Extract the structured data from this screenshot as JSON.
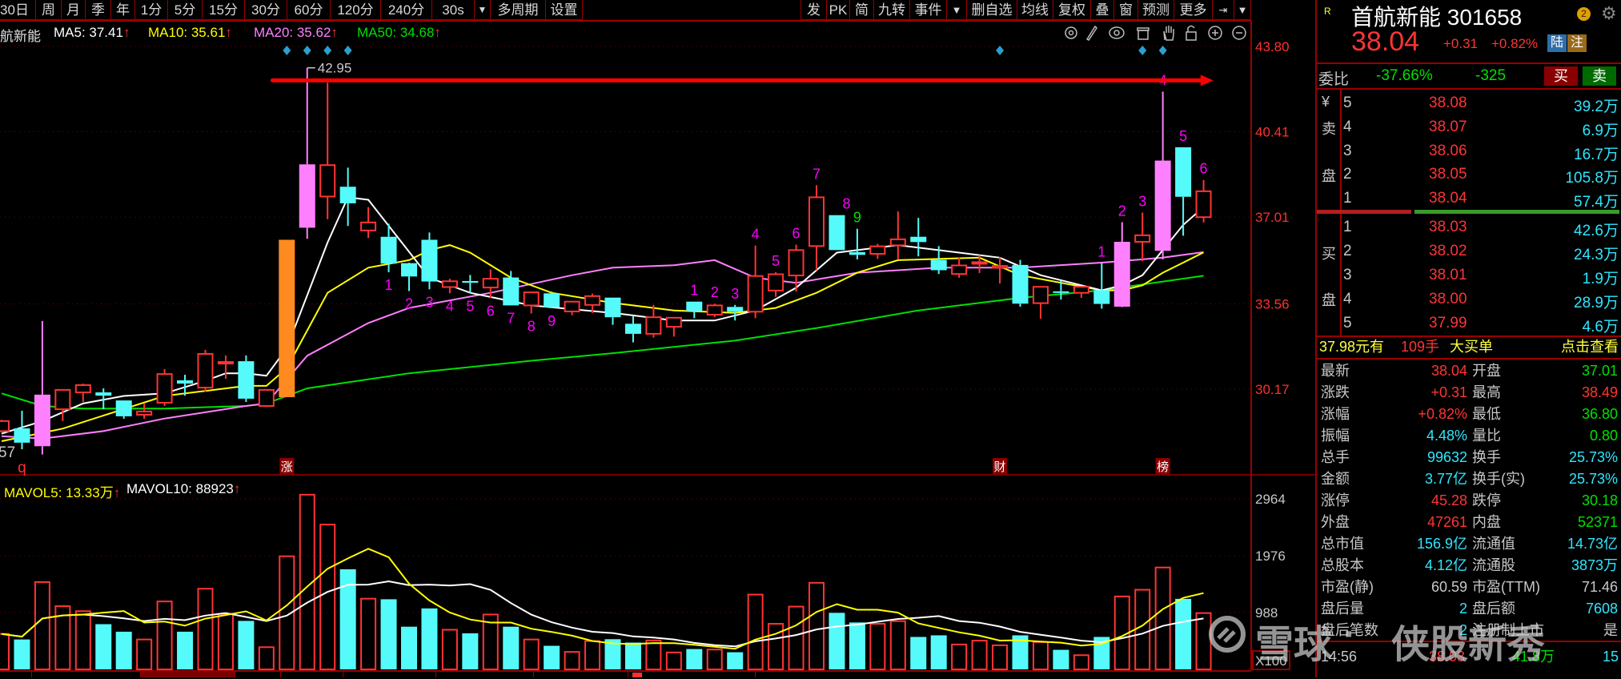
{
  "toolbar": {
    "left": [
      "30日",
      "周",
      "月",
      "季",
      "年",
      "1分",
      "5分",
      "15分",
      "30分",
      "60分",
      "120分",
      "240分",
      "30s",
      "多周期",
      "设置"
    ],
    "right": [
      "发",
      "PK",
      "简",
      "九转",
      "事件",
      "▼",
      "删自选",
      "均线",
      "复权",
      "叠",
      "窗",
      "预测",
      "更多",
      "⇥",
      "▼"
    ]
  },
  "legend": {
    "stock_name": "首航新能",
    "ma5": "MA5: 37.41",
    "ma10": "MA10: 35.61",
    "ma20": "MA20: 35.62",
    "ma50": "MA50: 34.68",
    "arrow": "↑",
    "mavol5": "MAVOL5: 13.33万",
    "mavol10": "MAVOL10: 88923"
  },
  "chart_tools": [
    "gear-icon",
    "pen-icon",
    "eye-icon",
    "basket-icon",
    "hand-icon",
    "lock-icon",
    "zoom-in-icon",
    "zoom-out-icon"
  ],
  "colors": {
    "up": "#ff3434",
    "down": "#55fbfb",
    "ma5": "#ffffff",
    "ma10": "#ffff00",
    "ma20": "#ff80ff",
    "ma50": "#00e000",
    "orange": "#ff8a20",
    "pink": "#ff80ff",
    "seq": "#ff00ff"
  },
  "chart_data": {
    "type": "candlestick",
    "price_axis": {
      "ticks": [
        "43.80",
        "40.41",
        "37.01",
        "33.56",
        "30.17"
      ],
      "values": [
        43.8,
        40.41,
        37.01,
        33.56,
        30.17
      ]
    },
    "volume_axis": {
      "ticks": [
        "2964",
        "1976",
        "988"
      ],
      "values": [
        2964,
        1976,
        988
      ],
      "unit_label": "X100"
    },
    "high_label": "42.95",
    "low_label": "57",
    "ohlc": [
      [
        28.5,
        28.95,
        28.45,
        28.9
      ],
      [
        28.61,
        29.31,
        27.78,
        28.04
      ],
      [
        27.9,
        32.88,
        27.57,
        29.95
      ],
      [
        29.37,
        30.14,
        28.9,
        30.14
      ],
      [
        30.04,
        30.39,
        29.66,
        30.33
      ],
      [
        30.04,
        30.2,
        29.37,
        29.91
      ],
      [
        29.72,
        29.72,
        28.99,
        29.09
      ],
      [
        29.15,
        29.6,
        28.99,
        29.28
      ],
      [
        29.63,
        30.97,
        29.5,
        30.77
      ],
      [
        30.52,
        30.74,
        29.91,
        30.39
      ],
      [
        30.23,
        31.73,
        30.07,
        31.57
      ],
      [
        31.19,
        31.51,
        30.58,
        31.25
      ],
      [
        31.28,
        31.51,
        29.66,
        29.79
      ],
      [
        29.5,
        30.14,
        29.47,
        30.14
      ],
      [
        29.85,
        36.11,
        29.85,
        36.11
      ],
      [
        36.59,
        42.95,
        36.15,
        39.11
      ],
      [
        37.83,
        42.36,
        36.93,
        39.08
      ],
      [
        38.22,
        38.98,
        36.66,
        37.56
      ],
      [
        36.48,
        37.41,
        36.18,
        36.8
      ],
      [
        36.23,
        36.75,
        34.82,
        35.16
      ],
      [
        35.18,
        35.2,
        34.07,
        34.65
      ],
      [
        36.11,
        36.4,
        34.14,
        34.45
      ],
      [
        34.23,
        34.56,
        33.98,
        34.46
      ],
      [
        34.47,
        34.71,
        33.98,
        34.4
      ],
      [
        34.21,
        34.93,
        33.79,
        34.56
      ],
      [
        34.61,
        34.87,
        33.5,
        33.5
      ],
      [
        33.5,
        34.02,
        33.18,
        34.02
      ],
      [
        33.98,
        34.05,
        33.39,
        33.43
      ],
      [
        33.26,
        33.65,
        33.11,
        33.65
      ],
      [
        33.52,
        33.97,
        33.2,
        33.87
      ],
      [
        33.81,
        33.81,
        32.73,
        33.03
      ],
      [
        32.77,
        33.09,
        32.03,
        32.37
      ],
      [
        32.37,
        33.52,
        32.22,
        33.03
      ],
      [
        32.65,
        33.01,
        32.26,
        33.01
      ],
      [
        33.65,
        33.65,
        32.99,
        33.27
      ],
      [
        33.13,
        33.57,
        33.04,
        33.5
      ],
      [
        33.44,
        33.52,
        32.9,
        33.25
      ],
      [
        33.25,
        35.88,
        32.99,
        34.67
      ],
      [
        34.09,
        34.82,
        33.84,
        34.74
      ],
      [
        34.69,
        35.92,
        34.05,
        35.7
      ],
      [
        35.86,
        38.28,
        34.9,
        37.8
      ],
      [
        37.09,
        37.09,
        35.7,
        35.7
      ],
      [
        35.62,
        36.55,
        35.33,
        35.51
      ],
      [
        35.55,
        35.95,
        35.35,
        35.85
      ],
      [
        35.89,
        37.24,
        35.34,
        36.13
      ],
      [
        36.23,
        36.98,
        35.45,
        36.02
      ],
      [
        35.31,
        35.86,
        34.75,
        34.9
      ],
      [
        34.75,
        35.42,
        34.6,
        35.09
      ],
      [
        35.2,
        35.5,
        34.79,
        35.22
      ],
      [
        35.0,
        35.42,
        34.37,
        35.07
      ],
      [
        35.11,
        35.31,
        33.45,
        33.57
      ],
      [
        33.59,
        34.24,
        32.97,
        34.24
      ],
      [
        34.06,
        34.49,
        33.73,
        34.04
      ],
      [
        34.0,
        34.24,
        33.8,
        34.24
      ],
      [
        34.11,
        35.18,
        33.37,
        33.56
      ],
      [
        33.45,
        36.81,
        33.43,
        36.03
      ],
      [
        36.03,
        37.19,
        35.26,
        36.29
      ],
      [
        35.67,
        42.0,
        35.33,
        39.26
      ],
      [
        39.79,
        39.79,
        36.27,
        37.82
      ],
      [
        37.01,
        38.49,
        36.8,
        38.04
      ]
    ],
    "special_fill": {
      "2": "pink",
      "14": "orange",
      "15": "pink",
      "55": "pink",
      "57": "pink"
    },
    "volume_x100": [
      617,
      520,
      1518,
      1099,
      1012,
      786,
      655,
      520,
      1181,
      655,
      1402,
      964,
      843,
      386,
      1966,
      3036,
      2516,
      1740,
      1229,
      1219,
      742,
      1060,
      689,
      627,
      954,
      742,
      520,
      410,
      304,
      492,
      525,
      466,
      503,
      294,
      354,
      345,
      298,
      1300,
      792,
      1091,
      1505,
      983,
      816,
      792,
      839,
      564,
      592,
      433,
      499,
      419,
      592,
      475,
      340,
      247,
      564,
      1268,
      1384,
      1771,
      1226,
      979
    ],
    "ma_knots": {
      "ma5": [
        [
          0,
          28.4
        ],
        [
          2,
          28.9
        ],
        [
          4,
          29.6
        ],
        [
          6,
          29.9
        ],
        [
          8,
          30.0
        ],
        [
          10,
          30.5
        ],
        [
          11,
          30.8
        ],
        [
          12,
          30.8
        ],
        [
          13,
          30.7
        ],
        [
          14,
          31.8
        ],
        [
          16,
          36.0
        ],
        [
          17,
          37.8
        ],
        [
          18,
          37.7
        ],
        [
          21,
          34.6
        ],
        [
          23,
          34.0
        ],
        [
          26,
          33.5
        ],
        [
          30,
          33.2
        ],
        [
          33,
          32.9
        ],
        [
          35,
          32.9
        ],
        [
          37,
          33.3
        ],
        [
          39,
          34.2
        ],
        [
          41,
          35.6
        ],
        [
          44,
          35.9
        ],
        [
          47,
          35.6
        ],
        [
          49,
          35.4
        ],
        [
          51,
          34.7
        ],
        [
          54,
          34.1
        ],
        [
          55,
          34.3
        ],
        [
          56,
          34.7
        ],
        [
          57,
          35.7
        ],
        [
          58,
          36.7
        ],
        [
          59,
          37.41
        ]
      ],
      "ma10": [
        [
          0,
          28.1
        ],
        [
          3,
          28.6
        ],
        [
          8,
          29.9
        ],
        [
          10,
          30.1
        ],
        [
          12,
          30.3
        ],
        [
          13,
          30.3
        ],
        [
          14,
          31.0
        ],
        [
          16,
          34.0
        ],
        [
          18,
          35.0
        ],
        [
          20,
          35.3
        ],
        [
          21,
          35.7
        ],
        [
          22,
          35.9
        ],
        [
          23,
          35.6
        ],
        [
          25,
          34.6
        ],
        [
          27,
          34.0
        ],
        [
          30,
          33.6
        ],
        [
          33,
          33.3
        ],
        [
          36,
          33.2
        ],
        [
          38,
          33.4
        ],
        [
          40,
          34.0
        ],
        [
          42,
          34.8
        ],
        [
          44,
          35.3
        ],
        [
          48,
          35.4
        ],
        [
          50,
          34.7
        ],
        [
          54,
          34.1
        ],
        [
          55,
          34.1
        ],
        [
          56,
          34.3
        ],
        [
          57,
          34.8
        ],
        [
          58,
          35.2
        ],
        [
          59,
          35.61
        ]
      ],
      "ma20": [
        [
          0,
          28.3
        ],
        [
          2,
          28.2
        ],
        [
          5,
          28.5
        ],
        [
          8,
          29.0
        ],
        [
          12,
          29.5
        ],
        [
          13,
          29.6
        ],
        [
          15,
          31.5
        ],
        [
          18,
          32.8
        ],
        [
          20,
          33.4
        ],
        [
          24,
          34.0
        ],
        [
          28,
          34.7
        ],
        [
          30,
          35.0
        ],
        [
          33,
          35.1
        ],
        [
          35,
          35.3
        ],
        [
          37,
          34.6
        ],
        [
          39,
          34.4
        ],
        [
          42,
          34.8
        ],
        [
          46,
          35.0
        ],
        [
          50,
          35.0
        ],
        [
          54,
          35.2
        ],
        [
          57,
          35.4
        ],
        [
          59,
          35.62
        ]
      ],
      "ma50": [
        [
          0,
          30.0
        ],
        [
          2,
          29.5
        ],
        [
          4,
          29.4
        ],
        [
          8,
          29.4
        ],
        [
          12,
          29.5
        ],
        [
          13,
          29.6
        ],
        [
          15,
          30.2
        ],
        [
          20,
          30.8
        ],
        [
          26,
          31.3
        ],
        [
          30,
          31.6
        ],
        [
          36,
          32.1
        ],
        [
          40,
          32.6
        ],
        [
          45,
          33.3
        ],
        [
          50,
          33.8
        ],
        [
          54,
          34.1
        ],
        [
          59,
          34.68
        ]
      ]
    },
    "sequence_labels": [
      {
        "i": 19,
        "t": "1",
        "pos": "below"
      },
      {
        "i": 20,
        "t": "2",
        "pos": "below"
      },
      {
        "i": 21,
        "t": "3",
        "pos": "below"
      },
      {
        "i": 22,
        "t": "4",
        "pos": "below"
      },
      {
        "i": 23,
        "t": "5",
        "pos": "below"
      },
      {
        "i": 24,
        "t": "6",
        "pos": "below"
      },
      {
        "i": 25,
        "t": "7",
        "pos": "below"
      },
      {
        "i": 26,
        "t": "8",
        "pos": "below"
      },
      {
        "i": 27,
        "t": "9",
        "pos": "below"
      },
      {
        "i": 34,
        "t": "1",
        "pos": "above"
      },
      {
        "i": 35,
        "t": "2",
        "pos": "above"
      },
      {
        "i": 36,
        "t": "3",
        "pos": "above"
      },
      {
        "i": 37,
        "t": "4",
        "pos": "above"
      },
      {
        "i": 38,
        "t": "5",
        "pos": "above"
      },
      {
        "i": 39,
        "t": "6",
        "pos": "above"
      },
      {
        "i": 40,
        "t": "7",
        "pos": "above"
      },
      {
        "i": 41,
        "t": "8",
        "pos": "above"
      },
      {
        "i": 42,
        "t": "9",
        "pos": "above",
        "green": true
      },
      {
        "i": 54,
        "t": "1",
        "pos": "above"
      },
      {
        "i": 55,
        "t": "2",
        "pos": "above"
      },
      {
        "i": 56,
        "t": "3",
        "pos": "above"
      },
      {
        "i": 57,
        "t": "4",
        "pos": "above"
      },
      {
        "i": 58,
        "t": "5",
        "pos": "above"
      },
      {
        "i": 59,
        "t": "6",
        "pos": "above"
      }
    ],
    "event_diamonds": [
      14,
      15,
      16,
      17,
      49,
      56,
      57
    ],
    "event_markers": [
      {
        "i": 1,
        "t": "q",
        "boxed": false
      },
      {
        "i": 14,
        "t": "涨",
        "boxed": true
      },
      {
        "i": 49,
        "t": "财",
        "boxed": true
      },
      {
        "i": 57,
        "t": "榜",
        "boxed": true
      }
    ],
    "resistance_line": {
      "price": 42.45,
      "from_index": 13.3,
      "to_index": 59.4
    }
  },
  "sidebar": {
    "market_tag": "R",
    "name_code": "首航新能 301658",
    "badge_count": "2",
    "price": "38.04",
    "change": "+0.31",
    "change_pct": "+0.82%",
    "tag_lu": "陆",
    "tag_zhu": "注",
    "weibi_label": "委比",
    "weibi_pct": "-37.66%",
    "weicha": "-325",
    "buy_btn": "买",
    "sell_btn": "卖",
    "sell_side_labels": [
      "¥",
      "卖",
      "盘"
    ],
    "buy_side_labels": [
      "买",
      "盘"
    ],
    "asks": [
      [
        "5",
        "38.08",
        "39.2万"
      ],
      [
        "4",
        "38.07",
        "6.9万"
      ],
      [
        "3",
        "38.06",
        "16.7万"
      ],
      [
        "2",
        "38.05",
        "105.8万"
      ],
      [
        "1",
        "38.04",
        "57.4万"
      ]
    ],
    "bids": [
      [
        "1",
        "38.03",
        "42.6万"
      ],
      [
        "2",
        "38.02",
        "24.3万"
      ],
      [
        "3",
        "38.01",
        "1.9万"
      ],
      [
        "4",
        "38.00",
        "28.9万"
      ],
      [
        "5",
        "37.99",
        "4.6万"
      ]
    ],
    "big_order": {
      "price": "37.98元有",
      "qty": "109手",
      "type": "大买单",
      "link": "点击查看"
    },
    "stats": [
      {
        "l1": "最新",
        "v1": "38.04",
        "c1": "red",
        "l2": "开盘",
        "v2": "37.01",
        "c2": "green"
      },
      {
        "l1": "涨跌",
        "v1": "+0.31",
        "c1": "red",
        "l2": "最高",
        "v2": "38.49",
        "c2": "red"
      },
      {
        "l1": "涨幅",
        "v1": "+0.82%",
        "c1": "red",
        "l2": "最低",
        "v2": "36.80",
        "c2": "green"
      },
      {
        "l1": "振幅",
        "v1": "4.48%",
        "c1": "cyan",
        "l2": "量比",
        "v2": "0.80",
        "c2": "green"
      },
      {
        "l1": "总手",
        "v1": "99632",
        "c1": "cyan",
        "l2": "换手",
        "v2": "25.73%",
        "c2": "cyan"
      },
      {
        "l1": "金额",
        "v1": "3.77亿",
        "c1": "cyan",
        "l2": "换手(实)",
        "v2": "25.73%",
        "c2": "cyan"
      },
      {
        "l1": "涨停",
        "v1": "45.28",
        "c1": "red",
        "l2": "跌停",
        "v2": "30.18",
        "c2": "green"
      },
      {
        "l1": "外盘",
        "v1": "47261",
        "c1": "red",
        "l2": "内盘",
        "v2": "52371",
        "c2": "green"
      },
      {
        "l1": "总市值",
        "v1": "156.9亿",
        "c1": "cyan",
        "l2": "流通值",
        "v2": "14.73亿",
        "c2": "cyan"
      },
      {
        "l1": "总股本",
        "v1": "4.12亿",
        "c1": "cyan",
        "l2": "流通股",
        "v2": "3873万",
        "c2": "cyan"
      },
      {
        "l1": "市盈(静)",
        "v1": "60.59",
        "c1": "gray",
        "l2": "市盈(TTM)",
        "v2": "71.46",
        "c2": "gray"
      },
      {
        "l1": "盘后量",
        "v1": "2",
        "c1": "cyan",
        "l2": "盘后额",
        "v2": "7608",
        "c2": "cyan"
      },
      {
        "l1": "盘后笔数",
        "v1": "2",
        "c1": "cyan",
        "l2": "注册制上市",
        "v2": "是",
        "c2": "gray"
      }
    ],
    "tick": {
      "time": "14:56",
      "price": "38.03",
      "volume": "41.8万",
      "count": "15"
    }
  },
  "watermark": {
    "brand": "雪球",
    "sep": "·",
    "author": "侠股新秀"
  }
}
